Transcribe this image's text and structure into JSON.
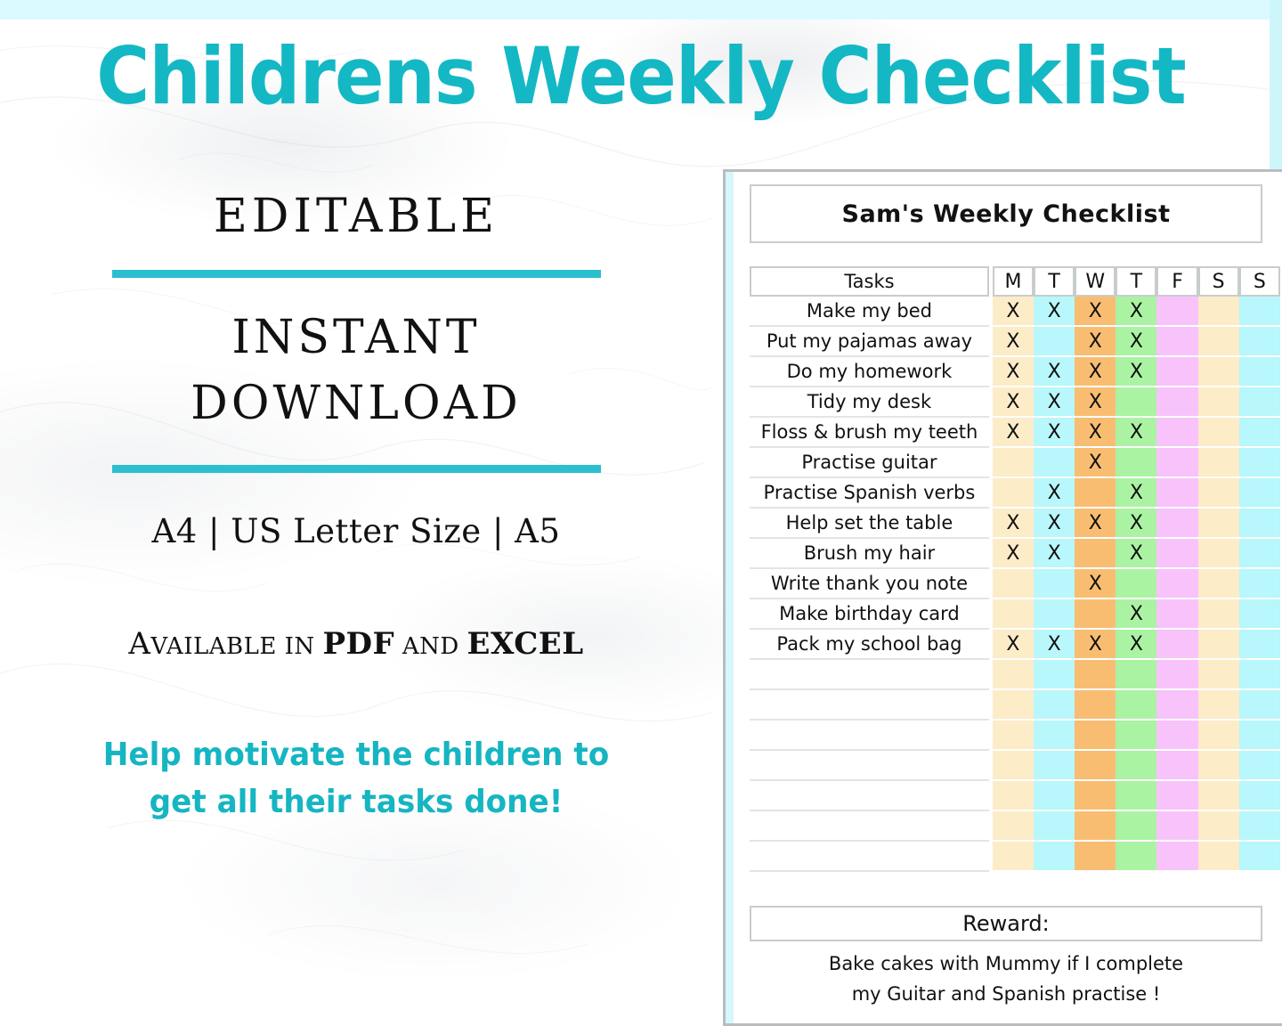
{
  "headline": "Childrens Weekly Checklist",
  "left_panel": {
    "editable_label": "EDITABLE",
    "instant_label": "INSTANT",
    "download_label": "DOWNLOAD",
    "sizes_label": "A4 | US Letter Size | A5",
    "available_prefix": "A",
    "available_line": "VAILABLE IN ",
    "available_pdf": "PDF",
    "available_and": " AND ",
    "available_excel": "EXCEL",
    "motivate_line1": "Help motivate the children to",
    "motivate_line2": "get all their tasks done!"
  },
  "checklist": {
    "title": "Sam's Weekly Checklist",
    "tasks_header": "Tasks",
    "days": [
      "M",
      "T",
      "W",
      "T",
      "F",
      "S",
      "S"
    ],
    "day_colors": [
      "#fdecc8",
      "#b8f7fb",
      "#f9bd72",
      "#aaf3a3",
      "#f8c3fb",
      "#fdecc8",
      "#b8f7fb"
    ],
    "rows": [
      {
        "task": "Make my bed",
        "marks": [
          "X",
          "X",
          "X",
          "X",
          "",
          "",
          ""
        ]
      },
      {
        "task": "Put my pajamas away",
        "marks": [
          "X",
          "",
          "X",
          "X",
          "",
          "",
          ""
        ]
      },
      {
        "task": "Do my homework",
        "marks": [
          "X",
          "X",
          "X",
          "X",
          "",
          "",
          ""
        ]
      },
      {
        "task": "Tidy my desk",
        "marks": [
          "X",
          "X",
          "X",
          "",
          "",
          "",
          ""
        ]
      },
      {
        "task": "Floss & brush my teeth",
        "marks": [
          "X",
          "X",
          "X",
          "X",
          "",
          "",
          ""
        ]
      },
      {
        "task": "Practise guitar",
        "marks": [
          "",
          "",
          "X",
          "",
          "",
          "",
          ""
        ]
      },
      {
        "task": "Practise Spanish verbs",
        "marks": [
          "",
          "X",
          "",
          "X",
          "",
          "",
          ""
        ]
      },
      {
        "task": "Help set the table",
        "marks": [
          "X",
          "X",
          "X",
          "X",
          "",
          "",
          ""
        ]
      },
      {
        "task": "Brush my hair",
        "marks": [
          "X",
          "X",
          "",
          "X",
          "",
          "",
          ""
        ]
      },
      {
        "task": "Write thank you note",
        "marks": [
          "",
          "",
          "X",
          "",
          "",
          "",
          ""
        ]
      },
      {
        "task": "Make birthday card",
        "marks": [
          "",
          "",
          "",
          "X",
          "",
          "",
          ""
        ]
      },
      {
        "task": "Pack my school bag",
        "marks": [
          "X",
          "X",
          "X",
          "X",
          "",
          "",
          ""
        ]
      },
      {
        "task": "",
        "marks": [
          "",
          "",
          "",
          "",
          "",
          "",
          ""
        ]
      },
      {
        "task": "",
        "marks": [
          "",
          "",
          "",
          "",
          "",
          "",
          ""
        ]
      },
      {
        "task": "",
        "marks": [
          "",
          "",
          "",
          "",
          "",
          "",
          ""
        ]
      },
      {
        "task": "",
        "marks": [
          "",
          "",
          "",
          "",
          "",
          "",
          ""
        ]
      },
      {
        "task": "",
        "marks": [
          "",
          "",
          "",
          "",
          "",
          "",
          ""
        ]
      },
      {
        "task": "",
        "marks": [
          "",
          "",
          "",
          "",
          "",
          "",
          ""
        ]
      },
      {
        "task": "",
        "marks": [
          "",
          "",
          "",
          "",
          "",
          "",
          ""
        ]
      }
    ],
    "reward_label": "Reward:",
    "reward_line1": "Bake cakes with Mummy if I complete",
    "reward_line2": "my Guitar and Spanish practise !"
  },
  "theme": {
    "teal": "#14b8c4",
    "bar_teal": "#2cbfcf",
    "edge_band": "#dbfaff",
    "panel_border": "#b9bdbf"
  }
}
